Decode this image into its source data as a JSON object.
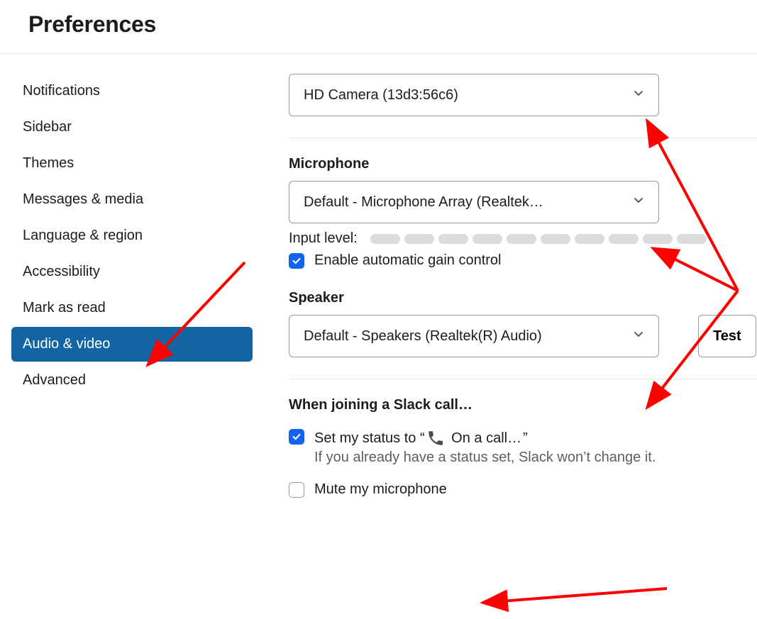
{
  "header": {
    "title": "Preferences"
  },
  "sidebar": {
    "items": [
      {
        "label": "Notifications"
      },
      {
        "label": "Sidebar"
      },
      {
        "label": "Themes"
      },
      {
        "label": "Messages & media"
      },
      {
        "label": "Language & region"
      },
      {
        "label": "Accessibility"
      },
      {
        "label": "Mark as read"
      },
      {
        "label": "Audio & video",
        "active": true
      },
      {
        "label": "Advanced"
      }
    ]
  },
  "main": {
    "camera_select": "HD Camera (13d3:56c6)",
    "microphone": {
      "heading": "Microphone",
      "select": "Default - Microphone Array (Realtek…",
      "input_level_label": "Input level:",
      "agc_label": "Enable automatic gain control",
      "agc_checked": true
    },
    "speaker": {
      "heading": "Speaker",
      "select": "Default - Speakers (Realtek(R) Audio)",
      "test_label": "Test"
    },
    "joining": {
      "heading": "When joining a Slack call…",
      "status_prefix": "Set my status to “",
      "status_text": "On a call…",
      "status_suffix": "”",
      "status_checked": true,
      "status_note": "If you already have a status set, Slack won’t change it.",
      "mute_label": "Mute my microphone",
      "mute_checked": false
    }
  }
}
